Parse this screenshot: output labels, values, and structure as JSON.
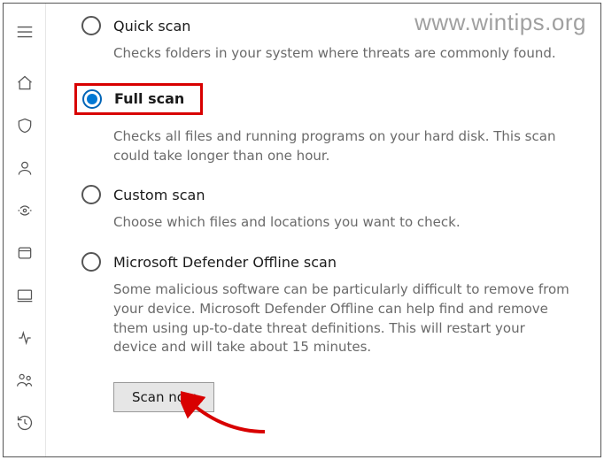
{
  "watermark": "www.wintips.org",
  "sidebar": {
    "items": [
      {
        "name": "menu-icon"
      },
      {
        "name": "home-icon"
      },
      {
        "name": "shield-icon"
      },
      {
        "name": "account-icon"
      },
      {
        "name": "firewall-icon"
      },
      {
        "name": "app-browser-icon"
      },
      {
        "name": "device-icon"
      },
      {
        "name": "performance-icon"
      },
      {
        "name": "family-icon"
      },
      {
        "name": "history-icon"
      }
    ]
  },
  "scanOptions": [
    {
      "id": "quick",
      "title": "Quick scan",
      "desc": "Checks folders in your system where threats are commonly found.",
      "selected": false,
      "highlighted": false
    },
    {
      "id": "full",
      "title": "Full scan",
      "desc": "Checks all files and running programs on your hard disk. This scan could take longer than one hour.",
      "selected": true,
      "highlighted": true
    },
    {
      "id": "custom",
      "title": "Custom scan",
      "desc": "Choose which files and locations you want to check.",
      "selected": false,
      "highlighted": false
    },
    {
      "id": "offline",
      "title": "Microsoft Defender Offline scan",
      "desc": "Some malicious software can be particularly difficult to remove from your device. Microsoft Defender Offline can help find and remove them using up-to-date threat definitions. This will restart your device and will take about 15 minutes.",
      "selected": false,
      "highlighted": false
    }
  ],
  "scanButton": {
    "label": "Scan now"
  }
}
